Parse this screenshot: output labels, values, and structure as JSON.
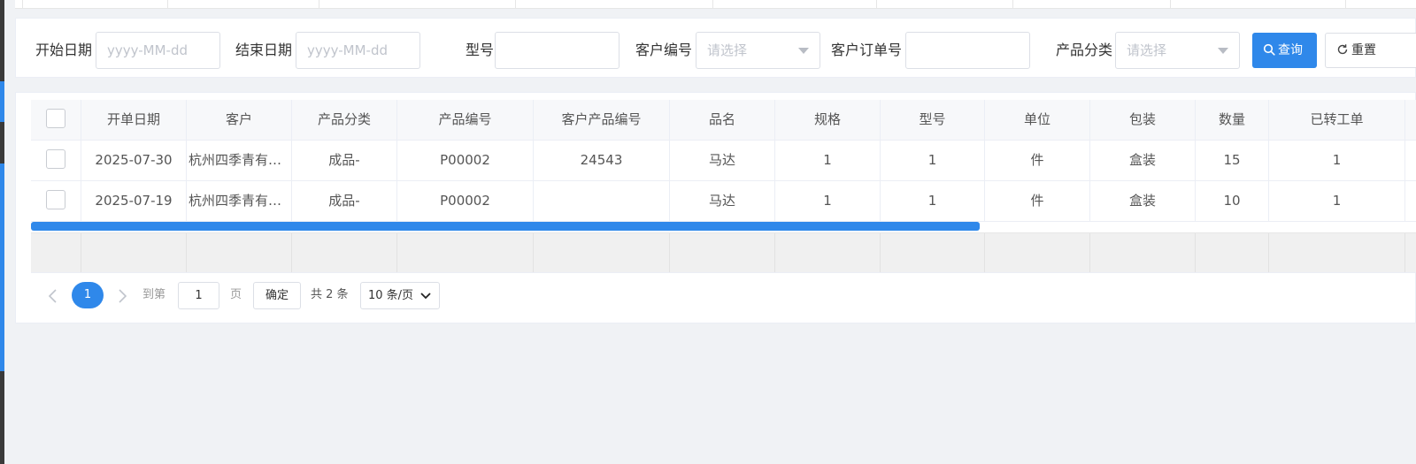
{
  "filters": {
    "start_date": {
      "label": "开始日期",
      "placeholder": "yyyy-MM-dd"
    },
    "end_date": {
      "label": "结束日期",
      "placeholder": "yyyy-MM-dd"
    },
    "model": {
      "label": "型号",
      "value": ""
    },
    "customer_code": {
      "label": "客户编号",
      "placeholder": "请选择"
    },
    "customer_order_no": {
      "label": "客户订单号",
      "value": ""
    },
    "product_category": {
      "label": "产品分类",
      "placeholder": "请选择"
    },
    "search_label": "查询",
    "reset_label": "重置"
  },
  "table": {
    "columns": [
      "开单日期",
      "客户",
      "产品分类",
      "产品编号",
      "客户产品编号",
      "品名",
      "规格",
      "型号",
      "单位",
      "包装",
      "数量",
      "已转工单"
    ],
    "rows": [
      [
        "2025-07-30",
        "杭州四季青有限公司",
        "成品-",
        "P00002",
        "24543",
        "马达",
        "1",
        "1",
        "件",
        "盒装",
        "15",
        "1"
      ],
      [
        "2025-07-19",
        "杭州四季青有限公司",
        "成品-",
        "P00002",
        "",
        "马达",
        "1",
        "1",
        "件",
        "盒装",
        "10",
        "1"
      ]
    ]
  },
  "pagination": {
    "current_page": "1",
    "goto_label": "到第",
    "goto_value": "1",
    "page_unit": "页",
    "confirm_label": "确定",
    "total_label": "共 2 条",
    "page_size_label": "10 条/页"
  },
  "colors": {
    "primary": "#2f88ea",
    "header_bg": "#f7f8fa",
    "border": "#ebeef5"
  }
}
